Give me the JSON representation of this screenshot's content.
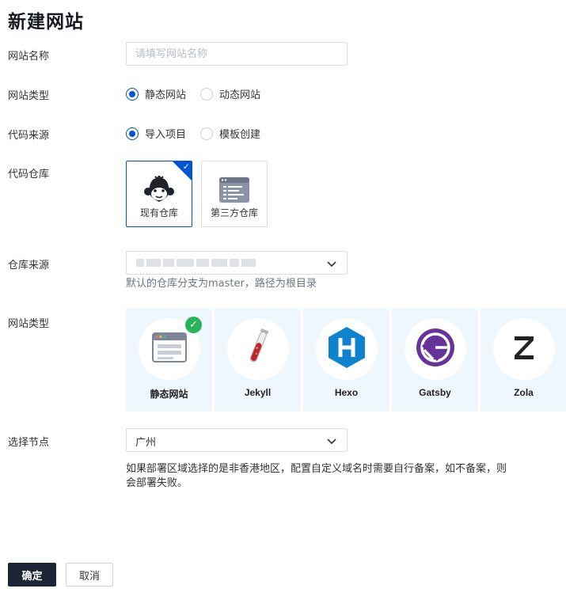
{
  "page": {
    "title": "新建网站"
  },
  "form": {
    "site_name": {
      "label": "网站名称",
      "placeholder": "请填写网站名称",
      "value": ""
    },
    "site_type": {
      "label": "网站类型",
      "options": [
        "静态网站",
        "动态网站"
      ],
      "selected": "静态网站"
    },
    "code_source": {
      "label": "代码来源",
      "options": [
        "导入项目",
        "模板创建"
      ],
      "selected": "导入项目"
    },
    "code_repo": {
      "label": "代码仓库",
      "cards": [
        {
          "label": "现有仓库",
          "icon": "monkey-icon",
          "selected": true
        },
        {
          "label": "第三方仓库",
          "icon": "repo-list-icon",
          "selected": false
        }
      ]
    },
    "repo_source": {
      "label": "仓库来源",
      "value": "",
      "hint": "默认的仓库分支为master，路径为根目录"
    },
    "framework": {
      "label": "网站类型",
      "items": [
        {
          "label": "静态网站",
          "icon": "browser-window-icon",
          "selected": true
        },
        {
          "label": "Jekyll",
          "icon": "jekyll-test-tube-icon",
          "selected": false
        },
        {
          "label": "Hexo",
          "icon": "hexo-hexagon-icon",
          "selected": false
        },
        {
          "label": "Gatsby",
          "icon": "gatsby-icon",
          "selected": false
        },
        {
          "label": "Zola",
          "icon": "zola-z-icon",
          "selected": false
        }
      ]
    },
    "node": {
      "label": "选择节点",
      "value": "广州",
      "hint": "如果部署区域选择的是非香港地区，配置自定义域名时需要自行备案，如不备案，则会部署失败。"
    }
  },
  "actions": {
    "confirm": "确定",
    "cancel": "取消"
  },
  "colors": {
    "primary": "#0052d9",
    "dark_button": "#1c2536",
    "success": "#29b35b",
    "card_bg": "#eef6fe"
  }
}
